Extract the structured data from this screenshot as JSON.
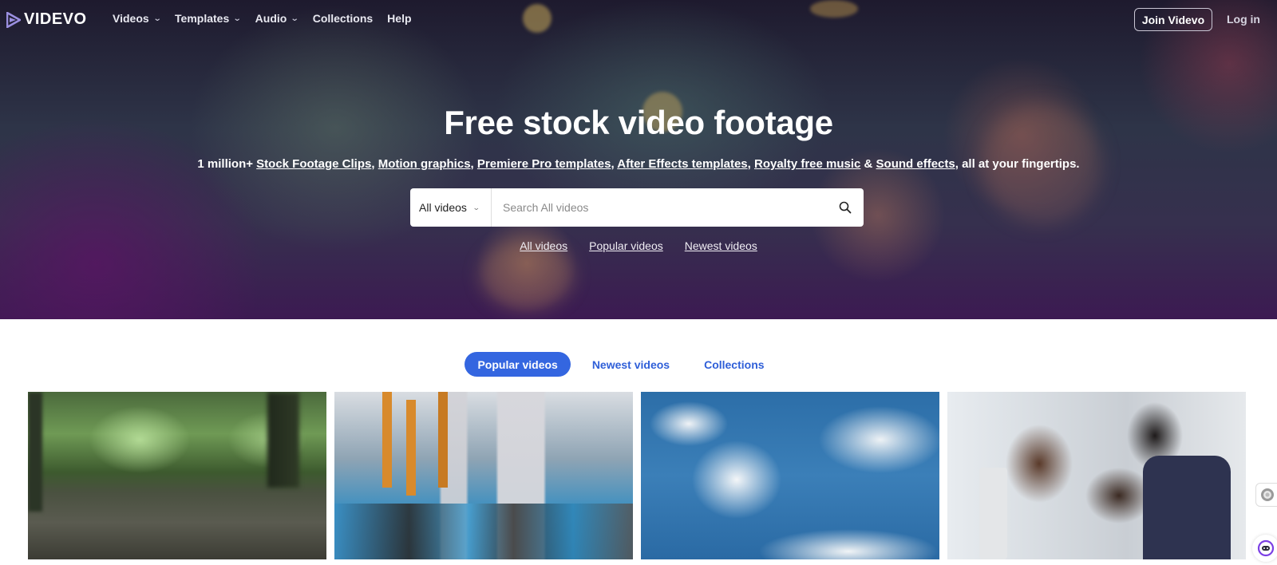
{
  "nav": {
    "logo_text": "VIDEVO",
    "items": [
      {
        "label": "Videos",
        "has_dropdown": true
      },
      {
        "label": "Templates",
        "has_dropdown": true
      },
      {
        "label": "Audio",
        "has_dropdown": true
      },
      {
        "label": "Collections",
        "has_dropdown": false
      },
      {
        "label": "Help",
        "has_dropdown": false
      }
    ],
    "join_label": "Join Videvo",
    "login_label": "Log in"
  },
  "hero": {
    "title": "Free stock video footage",
    "subtitle": {
      "prefix": "1 million+ ",
      "links": [
        "Stock Footage Clips",
        "Motion graphics",
        "Premiere Pro templates",
        "After Effects templates",
        "Royalty free music",
        "Sound effects"
      ],
      "separators": [
        ", ",
        ", ",
        ", ",
        ", ",
        " & "
      ],
      "suffix": ", all at your fingertips."
    },
    "search": {
      "category": "All videos",
      "placeholder": "Search All videos",
      "value": ""
    },
    "quick_links": [
      "All videos",
      "Popular videos",
      "Newest videos"
    ]
  },
  "tabs": [
    {
      "label": "Popular videos",
      "active": true
    },
    {
      "label": "Newest videos",
      "active": false
    },
    {
      "label": "Collections",
      "active": false
    }
  ],
  "thumbnails": [
    {
      "subject": "rain falling on forest ground"
    },
    {
      "subject": "industrial factory machinery"
    },
    {
      "subject": "white clouds in blue sky"
    },
    {
      "subject": "business team at computer"
    }
  ],
  "colors": {
    "accent": "#3466e0",
    "tab_text": "#2f5fd8"
  }
}
